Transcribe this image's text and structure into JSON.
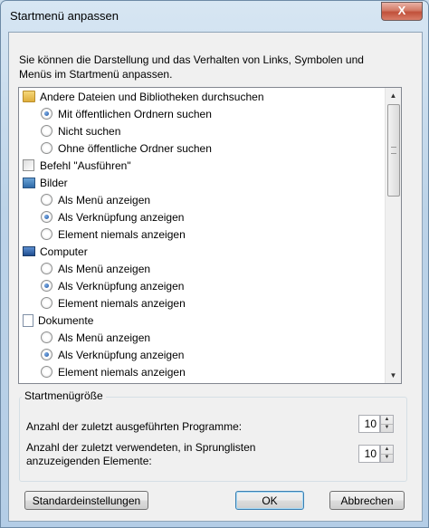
{
  "window": {
    "title": "Startmenü anpassen",
    "close_label": "X"
  },
  "description": "Sie können die Darstellung und das Verhalten von Links, Symbolen und Menüs im Startmenü anpassen.",
  "tree": {
    "items": [
      {
        "type": "category",
        "icon": "folder-icon",
        "label": "Andere Dateien und Bibliotheken durchsuchen"
      },
      {
        "type": "radio",
        "checked": true,
        "label": "Mit öffentlichen Ordnern suchen"
      },
      {
        "type": "radio",
        "checked": false,
        "label": "Nicht suchen"
      },
      {
        "type": "radio",
        "checked": false,
        "label": "Ohne öffentliche Ordner suchen"
      },
      {
        "type": "checkbox",
        "checked": false,
        "label": "Befehl \"Ausführen\""
      },
      {
        "type": "category",
        "icon": "pictures-icon",
        "label": "Bilder"
      },
      {
        "type": "radio",
        "checked": false,
        "label": "Als Menü anzeigen"
      },
      {
        "type": "radio",
        "checked": true,
        "label": "Als Verknüpfung anzeigen"
      },
      {
        "type": "radio",
        "checked": false,
        "label": "Element niemals anzeigen"
      },
      {
        "type": "category",
        "icon": "computer-icon",
        "label": "Computer"
      },
      {
        "type": "radio",
        "checked": false,
        "label": "Als Menü anzeigen"
      },
      {
        "type": "radio",
        "checked": true,
        "label": "Als Verknüpfung anzeigen"
      },
      {
        "type": "radio",
        "checked": false,
        "label": "Element niemals anzeigen"
      },
      {
        "type": "category",
        "icon": "documents-icon",
        "label": "Dokumente"
      },
      {
        "type": "radio",
        "checked": false,
        "label": "Als Menü anzeigen"
      },
      {
        "type": "radio",
        "checked": true,
        "label": "Als Verknüpfung anzeigen"
      },
      {
        "type": "radio",
        "checked": false,
        "label": "Element niemals anzeigen"
      }
    ]
  },
  "size_group": {
    "title": "Startmenügröße",
    "recent_programs_label": "Anzahl der zuletzt ausgeführten Programme:",
    "recent_programs_value": "10",
    "jumplist_label": "Anzahl der zuletzt verwendeten, in Sprunglisten anzuzeigenden Elemente:",
    "jumplist_value": "10"
  },
  "buttons": {
    "defaults": "Standardeinstellungen",
    "ok": "OK",
    "cancel": "Abbrechen"
  }
}
